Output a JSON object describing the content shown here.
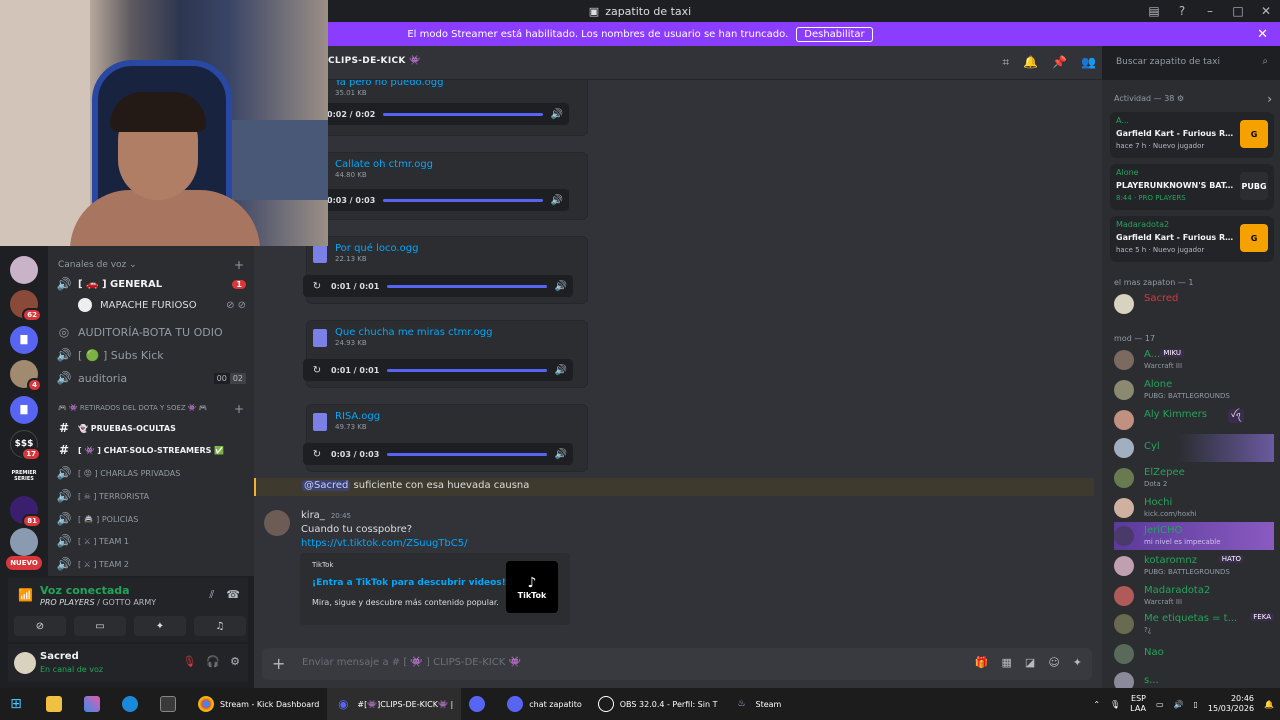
{
  "window": {
    "title": "zapatito de taxi"
  },
  "banner": {
    "text": "El modo Streamer está habilitado. Los nombres de usuario se han truncado.",
    "button": "Deshabilitar"
  },
  "rail": {
    "badges": [
      "62",
      "4",
      "17",
      "81"
    ],
    "labels": {
      "dollar": "$$$",
      "premier": "PREMIER SERIES",
      "new": "NUEVO"
    }
  },
  "channels": {
    "voice_category": "Canales de voz",
    "items": [
      {
        "name": "[ 🚗 ] GENERAL",
        "badge": "1"
      },
      {
        "name": "MAPACHE FURIOSO"
      },
      {
        "name": "AUDITORÍA-BOTA TU ODIO"
      },
      {
        "name": "[ 🟢 ] Subs Kick"
      },
      {
        "name": "auditoria",
        "counts": [
          "00",
          "02"
        ]
      }
    ],
    "category2": "🎮 👾 RETIRADOS DEL DOTA Y SOEZ 👾 🎮",
    "items2": [
      {
        "name": "👻 PRUEBAS-OCULTAS"
      },
      {
        "name": "[ 👾 ] CHAT-SOLO-STREAMERS ✅"
      },
      {
        "name": "[ 😡 ] CHARLAS PRIVADAS"
      },
      {
        "name": "[ ☠ ] TERRORISTA"
      },
      {
        "name": "[ 🚔 ] POLICIAS"
      },
      {
        "name": "[ ⚔ ] TEAM 1"
      },
      {
        "name": "[ ⚔ ] TEAM 2"
      }
    ]
  },
  "voice": {
    "title": "Voz conectada",
    "status": "PRO PLAYERS",
    "server": " / GOTTO ARMY"
  },
  "user": {
    "name": "Sacred",
    "status": "En canal de voz"
  },
  "chat": {
    "channel": "CLIPS-DE-KICK 👾",
    "search_placeholder": "Buscar zapatito de taxi",
    "attachments": [
      {
        "name": "Ya pero no puedo.ogg",
        "size": "35.01 KB",
        "time": "0:02 / 0:02"
      },
      {
        "name": "Callate oh ctmr.ogg",
        "size": "44.80 KB",
        "time": "0:03 / 0:03"
      },
      {
        "name": "Por qué loco.ogg",
        "size": "22.13 KB",
        "time": "0:01 / 0:01"
      },
      {
        "name": "Que chucha me miras ctmr.ogg",
        "size": "24.93 KB",
        "time": "0:01 / 0:01"
      },
      {
        "name": "RISA.ogg",
        "size": "49.73 KB",
        "time": "0:03 / 0:03"
      }
    ],
    "mention": {
      "tag": "@Sacred",
      "text": " suficiente con esa huevada causna"
    },
    "message": {
      "author": "kira_",
      "time": "20:45",
      "text": "Cuando tu cosspobre?",
      "link": "https://vt.tiktok.com/ZSuugTbC5/",
      "embed": {
        "provider": "TikTok",
        "title": "¡Entra a TikTok para descubrir videos!",
        "desc": "Mira, sigue y descubre más contenido popular.",
        "thumb": "TikTok"
      }
    },
    "composer_placeholder": "Enviar mensaje a # [ 👾 ] CLIPS-DE-KICK 👾"
  },
  "sidebar": {
    "activity_header": "Actividad — 38",
    "activities": [
      {
        "name": "A...",
        "game": "Garfield Kart - Furious Rac...",
        "meta": "hace 7 h · Nuevo jugador",
        "icon": "G"
      },
      {
        "name": "Alone",
        "game": "PLAYERUNKNOWN'S BAT...",
        "meta": "8:44 · PRO PLAYERS",
        "icon": "PUBG"
      },
      {
        "name": "Madaradota2",
        "game": "Garfield Kart - Furious Rac...",
        "meta": "hace 5 h · Nuevo jugador",
        "icon": "G"
      }
    ],
    "role1": "el mas zapaton — 1",
    "role1_member": "Sacred",
    "role2": "mod — 17",
    "members": [
      {
        "name": "A...",
        "sub": "Warcraft III",
        "tag": "MIKU"
      },
      {
        "name": "Alone",
        "sub": "PUBG: BATTLEGROUNDS"
      },
      {
        "name": "Aly Kimmers",
        "sub": "",
        "tag": "ꪜꪖ"
      },
      {
        "name": "Cyl",
        "sub": ""
      },
      {
        "name": "ElZepee",
        "sub": "Dota 2"
      },
      {
        "name": "Hochi",
        "sub": "kick.com/hoxhi"
      },
      {
        "name": "JeriCHO",
        "sub": "mi nivel es impecable"
      },
      {
        "name": "kotaromnz",
        "sub": "PUBG: BATTLEGROUNDS",
        "tag": "HATO"
      },
      {
        "name": "Madaradota2",
        "sub": "Warcraft III"
      },
      {
        "name": "Me etiquetas = t...",
        "sub": "?¿",
        "tag": "FEKA"
      },
      {
        "name": "Nao",
        "sub": ""
      },
      {
        "name": "s...",
        "sub": ""
      }
    ]
  },
  "taskbar": {
    "items": [
      "Stream - Kick Dashboard",
      "#[👾]CLIPS-DE-KICK👾 |",
      "",
      "chat zapatito",
      "OBS 32.0.4 - Perfil: Sin T",
      "Steam"
    ],
    "lang": "ESP",
    "lang2": "LAA",
    "time": "20:46",
    "date": "15/03/2026"
  }
}
